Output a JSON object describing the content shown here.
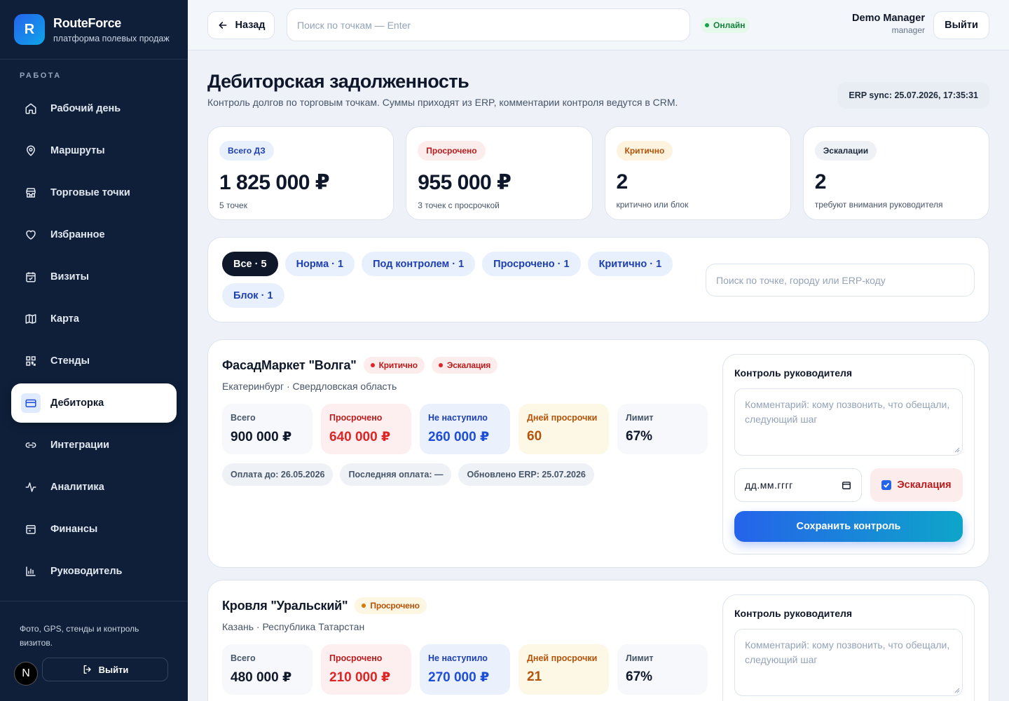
{
  "brand": {
    "logo_letter": "R",
    "name": "RouteForce",
    "subtitle": "платформа полевых продаж"
  },
  "sidebar": {
    "section_label": "РАБОТА",
    "items": [
      {
        "label": "Рабочий день",
        "icon": "home-icon"
      },
      {
        "label": "Маршруты",
        "icon": "map-pin-icon"
      },
      {
        "label": "Торговые точки",
        "icon": "store-icon"
      },
      {
        "label": "Избранное",
        "icon": "heart-icon"
      },
      {
        "label": "Визиты",
        "icon": "calendar-check-icon"
      },
      {
        "label": "Карта",
        "icon": "map-icon"
      },
      {
        "label": "Стенды",
        "icon": "qr-grid-icon"
      },
      {
        "label": "Дебиторка",
        "icon": "card-icon",
        "active": true
      },
      {
        "label": "Интеграции",
        "icon": "link-icon"
      },
      {
        "label": "Аналитика",
        "icon": "activity-icon"
      },
      {
        "label": "Финансы",
        "icon": "wallet-icon"
      },
      {
        "label": "Руководитель",
        "icon": "bar-chart-icon"
      }
    ],
    "footer_text": "Фото, GPS, стенды и контроль визитов.",
    "logout_label": "Выйти",
    "avatar_letter": "N"
  },
  "topbar": {
    "back_label": "Назад",
    "search_placeholder": "Поиск по точкам — Enter",
    "status": "Онлайн",
    "user_name": "Demo Manager",
    "user_role": "manager",
    "exit_label": "Выйти"
  },
  "page": {
    "title": "Дебиторская задолженность",
    "subtitle": "Контроль долгов по торговым точкам. Суммы приходят из ERP, комментарии контроля ведутся в CRM.",
    "erp_sync": "ERP sync: 25.07.2026, 17:35:31"
  },
  "stats": [
    {
      "label": "Всего ДЗ",
      "value": "1 825 000 ₽",
      "note": "5 точек",
      "pill_bg": "#e8f0fd",
      "pill_color": "#1e40af"
    },
    {
      "label": "Просрочено",
      "value": "955 000 ₽",
      "note": "3 точек с просрочкой",
      "pill_bg": "#fdecec",
      "pill_color": "#b91c1c"
    },
    {
      "label": "Критично",
      "value": "2",
      "note": "критично или блок",
      "pill_bg": "#fdf3df",
      "pill_color": "#b45309"
    },
    {
      "label": "Эскалации",
      "value": "2",
      "note": "требуют внимания руководителя",
      "pill_bg": "#eef1f5",
      "pill_color": "#1e293b"
    }
  ],
  "filters": {
    "chips": [
      "Все · 5",
      "Норма · 1",
      "Под контролем · 1",
      "Просрочено · 1",
      "Критично · 1",
      "Блок · 1"
    ],
    "search_placeholder": "Поиск по точке, городу или ERP-коду"
  },
  "labels": {
    "total": "Всего",
    "overdue": "Просрочено",
    "not_due": "Не наступило",
    "days": "Дней просрочки",
    "limit": "Лимит",
    "control_title": "Контроль руководителя",
    "comment_placeholder": "Комментарий: кому позвонить, что обещали, следующий шаг",
    "date_placeholder": "дд.мм.гггг",
    "escalation": "Эскалация",
    "save": "Сохранить контроль"
  },
  "debts": [
    {
      "name": "ФасадМаркет \"Волга\"",
      "location": "Екатеринбург · Свердловская область",
      "tags": [
        {
          "label": "Критично",
          "kind": "crit"
        },
        {
          "label": "Эскалация",
          "kind": "crit"
        }
      ],
      "total": "900 000 ₽",
      "overdue": "640 000 ₽",
      "not_due": "260 000 ₽",
      "days": "60",
      "limit": "67%",
      "meta": [
        "Оплата до: 26.05.2026",
        "Последняя оплата: —",
        "Обновлено ERP: 25.07.2026"
      ],
      "escalation_checked": true
    },
    {
      "name": "Кровля \"Уральский\"",
      "location": "Казань · Республика Татарстан",
      "tags": [
        {
          "label": "Просрочено",
          "kind": "over"
        }
      ],
      "total": "480 000 ₽",
      "overdue": "210 000 ₽",
      "not_due": "270 000 ₽",
      "days": "21",
      "limit": "67%",
      "meta": [],
      "escalation_checked": false
    }
  ]
}
